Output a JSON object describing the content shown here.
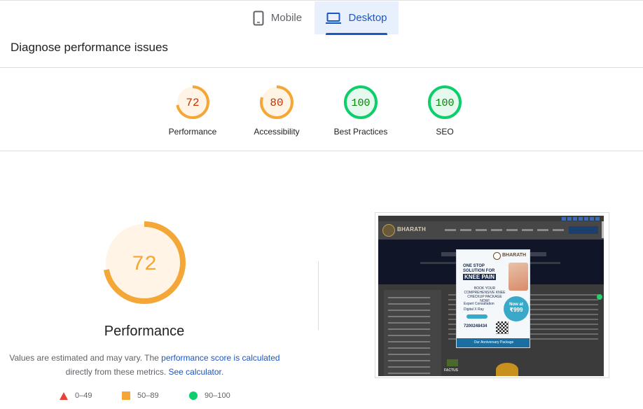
{
  "tabs": [
    {
      "label": "Mobile",
      "icon": "phone-icon",
      "selected": false
    },
    {
      "label": "Desktop",
      "icon": "laptop-icon",
      "selected": true
    }
  ],
  "section_title": "Diagnose performance issues",
  "scores": [
    {
      "value": "72",
      "label": "Performance",
      "fraction": 0.72,
      "color": "#f4a637",
      "fill": "#fff4e5",
      "text_color": "#c33300"
    },
    {
      "value": "80",
      "label": "Accessibility",
      "fraction": 0.8,
      "color": "#f4a637",
      "fill": "#fff4e5",
      "text_color": "#c33300"
    },
    {
      "value": "100",
      "label": "Best Practices",
      "fraction": 1.0,
      "color": "#0cce6b",
      "fill": "#e6f9ee",
      "text_color": "#008800"
    },
    {
      "value": "100",
      "label": "SEO",
      "fraction": 1.0,
      "color": "#0cce6b",
      "fill": "#e6f9ee",
      "text_color": "#008800"
    }
  ],
  "main": {
    "score": "72",
    "fraction": 0.72,
    "title": "Performance",
    "note_prefix": "Values are estimated and may vary. The ",
    "note_link1": "performance score is calculated",
    "note_middle": " directly from these metrics. ",
    "note_link2": "See calculator",
    "note_suffix": "."
  },
  "legend": [
    {
      "range": "0–49",
      "shape": "triangle",
      "color": "#e8433a"
    },
    {
      "range": "50–89",
      "shape": "square",
      "color": "#f4a637"
    },
    {
      "range": "90–100",
      "shape": "circle",
      "color": "#0cce6b"
    }
  ],
  "thumbnail": {
    "brand": "BHARATH",
    "popup_brand": "BHARATH",
    "popup_line1": "ONE STOP SOLUTION FOR",
    "popup_line2": "KNEE PAIN",
    "popup_line3": "BOOK YOUR COMPREHENSIVE KNEE CHECKUP PACKAGE NOW!",
    "popup_bullet1": "Expert Consultation",
    "popup_bullet2": "Digital X Ray",
    "popup_now": "Now at",
    "popup_price": "₹999",
    "popup_phone": "7200248434",
    "popup_footer": "Our Anniversary Package",
    "factus": "FACTUS"
  }
}
